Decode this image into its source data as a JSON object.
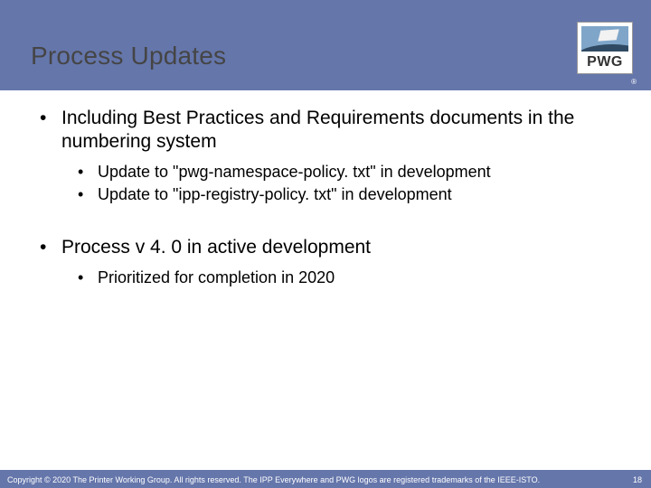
{
  "header": {
    "title": "Process Updates",
    "logo_text": "PWG",
    "trademark": "®"
  },
  "bullets": [
    {
      "text": "Including Best Practices and Requirements documents in the numbering system",
      "children": [
        "Update to \"pwg-namespace-policy. txt\" in development",
        "Update to \"ipp-registry-policy. txt\" in development"
      ]
    },
    {
      "text": "Process v 4. 0 in active development",
      "children": [
        "Prioritized for completion in 2020"
      ]
    }
  ],
  "footer": {
    "copyright": "Copyright © 2020 The Printer Working Group. All rights reserved. The IPP Everywhere and PWG logos are registered trademarks of the IEEE-ISTO.",
    "page": "18"
  }
}
